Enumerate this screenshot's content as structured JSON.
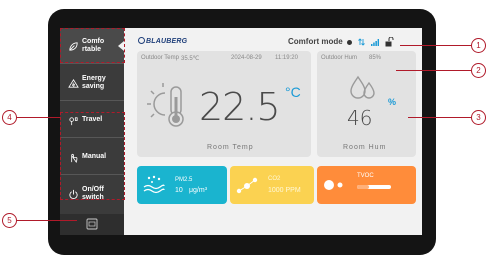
{
  "sidebar": {
    "items": [
      {
        "label": "Comfo rtable",
        "icon": "leaf-icon",
        "active": true
      },
      {
        "label": "Energy saving",
        "icon": "energy-icon",
        "active": false
      },
      {
        "label": "Travel",
        "icon": "travel-icon",
        "active": false
      },
      {
        "label": "Manual",
        "icon": "hand-icon",
        "active": false
      },
      {
        "label": "On/Off switch",
        "icon": "power-icon",
        "active": false
      }
    ],
    "bottom_icon": "screen-icon"
  },
  "header": {
    "brand": "BLAUBERG",
    "mode": "Comfort mode",
    "icons": [
      "status-dot-icon",
      "signal-arrows-icon",
      "wifi-bars-icon",
      "unlock-icon"
    ]
  },
  "temperature": {
    "outdoor_label": "Outdoor Temp",
    "outdoor_value": "35.5℃",
    "date": "2024-08-29",
    "time": "11:19:20",
    "value": "22.5",
    "unit": "°C",
    "label": "Room Temp"
  },
  "humidity": {
    "outdoor_label": "Outdoor Hum",
    "outdoor_value": "85%",
    "value": "46",
    "unit": "%",
    "label": "Room Hum"
  },
  "tiles": {
    "pm25": {
      "label": "PM2.5",
      "value": "10",
      "unit": "μg/m³"
    },
    "co2": {
      "label": "CO2",
      "value": "1000 PPM"
    },
    "tvoc": {
      "label": "TVOC",
      "level": 0.35
    }
  },
  "callouts": [
    "1",
    "2",
    "3",
    "4",
    "5"
  ],
  "colors": {
    "accent": "#1a9ad6",
    "callout": "#b01a2a",
    "blue_tile": "#1ab4cf",
    "yellow_tile": "#fbd251",
    "orange_tile": "#ff8c3a"
  }
}
